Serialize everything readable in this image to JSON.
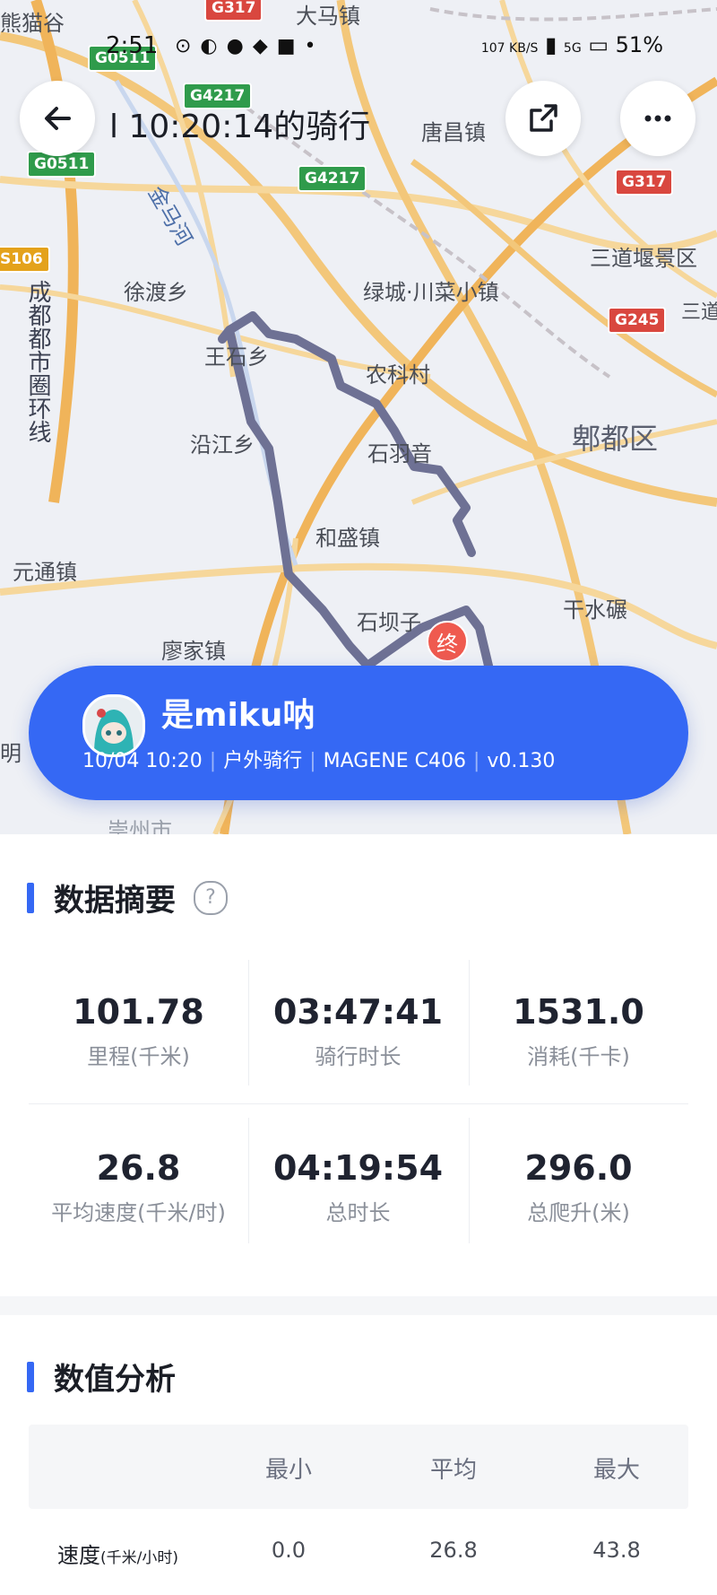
{
  "status_bar": {
    "time": "2:51",
    "net_speed": "107 KB/S",
    "network": "5G",
    "battery": "51%"
  },
  "header": {
    "title": "l 10:20:14的骑行"
  },
  "map": {
    "labels": [
      "熊猫谷",
      "大马镇",
      "唐昌镇",
      "徐渡乡",
      "绿城·川菜小镇",
      "三道堰景区",
      "王石乡",
      "农科村",
      "沿江乡",
      "石羽音",
      "郫都区",
      "和盛镇",
      "元通镇",
      "石坝子",
      "干水碾",
      "廖家镇",
      "明",
      "崇州市",
      "三道杠",
      "金马河",
      "成都都市圈环线"
    ],
    "shields": [
      "G0511",
      "G4217",
      "G317",
      "G0511",
      "G4217",
      "S106",
      "G317",
      "G245"
    ],
    "end_marker": "终"
  },
  "activity": {
    "username": "是miku呐",
    "date_time": "10/04 10:20",
    "type": "户外骑行",
    "device": "MAGENE C406",
    "version": "v0.130"
  },
  "summary": {
    "title": "数据摘要",
    "help": "?",
    "stats": [
      {
        "value": "101.78",
        "label": "里程(千米)"
      },
      {
        "value": "03:47:41",
        "label": "骑行时长"
      },
      {
        "value": "1531.0",
        "label": "消耗(千卡)"
      },
      {
        "value": "26.8",
        "label": "平均速度(千米/时)"
      },
      {
        "value": "04:19:54",
        "label": "总时长"
      },
      {
        "value": "296.0",
        "label": "总爬升(米)"
      }
    ]
  },
  "analysis": {
    "title": "数值分析",
    "columns": [
      "最小",
      "平均",
      "最大"
    ],
    "rows": [
      {
        "name": "速度",
        "unit": "(千米/小时)",
        "min": "0.0",
        "avg": "26.8",
        "max": "43.8"
      }
    ]
  },
  "colors": {
    "accent": "#3568f4",
    "route": "#6e7194",
    "end_marker": "#ef5a4f"
  }
}
